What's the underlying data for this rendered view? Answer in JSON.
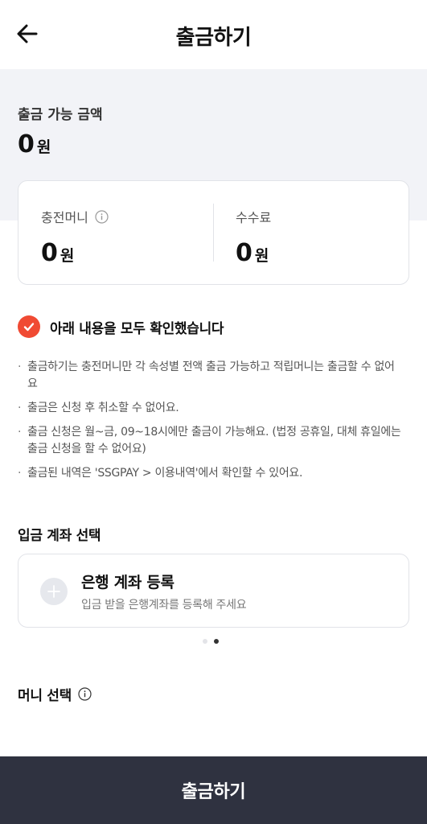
{
  "header": {
    "title": "출금하기",
    "back_icon": "arrow-left-icon"
  },
  "summary": {
    "available_label": "출금 가능 금액",
    "available_amount": "0",
    "unit": "원"
  },
  "money_card": {
    "charge": {
      "label": "충전머니",
      "amount": "0",
      "unit": "원",
      "icon": "info-icon"
    },
    "fee": {
      "label": "수수료",
      "amount": "0",
      "unit": "원"
    }
  },
  "confirm": {
    "label": "아래 내용을 모두 확인했습니다",
    "checked": true,
    "color": "#f04a33"
  },
  "notes": [
    "출금하기는 충전머니만 각 속성별 전액 출금 가능하고 적립머니는 출금할 수 없어요",
    "출금은 신청 후 취소할 수 없어요.",
    "출금 신청은 월~금, 09~18시에만 출금이 가능해요. (법정 공휴일, 대체 휴일에는 출금 신청을 할 수 없어요)",
    "출금된 내역은 'SSGPAY > 이용내역'에서 확인할 수 있어요."
  ],
  "deposit": {
    "section_title": "입금 계좌 선택",
    "card_title": "은행 계좌 등록",
    "card_subtitle": "입금 받을 은행계좌를 등록해 주세요"
  },
  "money_select": {
    "section_title": "머니 선택"
  },
  "footer": {
    "button_label": "출금하기",
    "color": "#2f3240"
  }
}
